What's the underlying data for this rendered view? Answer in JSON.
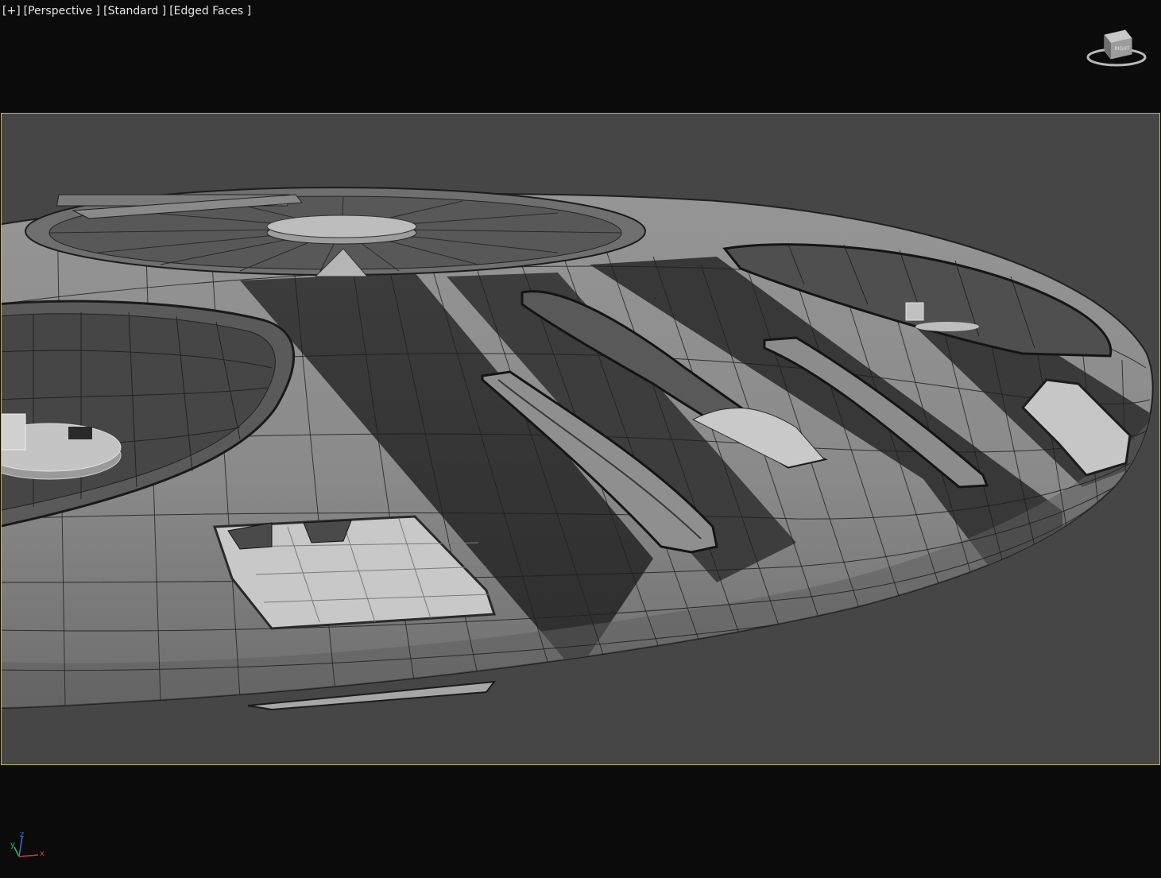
{
  "viewport": {
    "labels": [
      {
        "text": "[+]",
        "name": "viewport-menu-plus"
      },
      {
        "text": "[Perspective ]",
        "name": "viewport-point-of-view-menu"
      },
      {
        "text": "[Standard ]",
        "name": "viewport-shading-standard-menu"
      },
      {
        "text": "[Edged Faces ]",
        "name": "viewport-visual-style-menu"
      }
    ]
  },
  "viewcube": {
    "face_label": "RIGHT",
    "icon": "viewcube-icon"
  },
  "axis_tripod": {
    "x": "x",
    "y": "y",
    "z": "z"
  },
  "colors": {
    "background": "#0b0b0b",
    "safe_frame": "#b7b35a",
    "viewport_bg": "#464646",
    "light_panel": "#8e8e8e",
    "dark_band": "#3a3a3a",
    "wire": "#1c1c1c"
  }
}
